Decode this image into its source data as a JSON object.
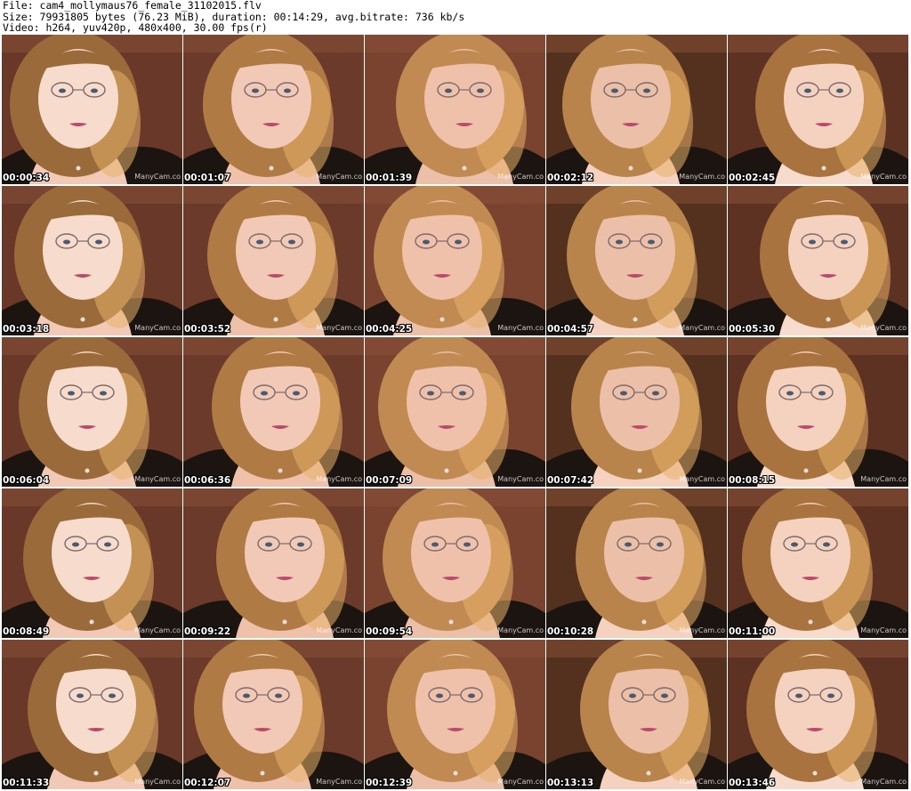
{
  "header": {
    "file": "File: cam4_mollymaus76_female_31102015.flv",
    "size": "Size: 79931805 bytes (76.23 MiB), duration: 00:14:29, avg.bitrate: 736 kb/s",
    "video": "Video: h264, yuv420p, 480x400, 30.00 fps(r)"
  },
  "thumbs": [
    {
      "ts": "00:00:34",
      "wm": "ManyCam.co"
    },
    {
      "ts": "00:01:07",
      "wm": "ManyCam.co"
    },
    {
      "ts": "00:01:39",
      "wm": "ManyCam.co"
    },
    {
      "ts": "00:02:12",
      "wm": "ManyCam.co"
    },
    {
      "ts": "00:02:45",
      "wm": "ManyCam.co"
    },
    {
      "ts": "00:03:18",
      "wm": "ManyCam.co"
    },
    {
      "ts": "00:03:52",
      "wm": "ManyCam.co"
    },
    {
      "ts": "00:04:25",
      "wm": "ManyCam.co"
    },
    {
      "ts": "00:04:57",
      "wm": "ManyCam.co"
    },
    {
      "ts": "00:05:30",
      "wm": "ManyCam.co"
    },
    {
      "ts": "00:06:04",
      "wm": "ManyCam.co"
    },
    {
      "ts": "00:06:36",
      "wm": "ManyCam.co"
    },
    {
      "ts": "00:07:09",
      "wm": "ManyCam.co"
    },
    {
      "ts": "00:07:42",
      "wm": "ManyCam.co"
    },
    {
      "ts": "00:08:15",
      "wm": "ManyCam.co"
    },
    {
      "ts": "00:08:49",
      "wm": "ManyCam.co"
    },
    {
      "ts": "00:09:22",
      "wm": "ManyCam.co"
    },
    {
      "ts": "00:09:54",
      "wm": "ManyCam.co"
    },
    {
      "ts": "00:10:28",
      "wm": "ManyCam.co"
    },
    {
      "ts": "00:11:00",
      "wm": "ManyCam.co"
    },
    {
      "ts": "00:11:33",
      "wm": "ManyCam.co"
    },
    {
      "ts": "00:12:07",
      "wm": "ManyCam.co"
    },
    {
      "ts": "00:12:39",
      "wm": "ManyCam.co"
    },
    {
      "ts": "00:13:13",
      "wm": "ManyCam.co"
    },
    {
      "ts": "00:13:46",
      "wm": "ManyCam.co"
    }
  ]
}
